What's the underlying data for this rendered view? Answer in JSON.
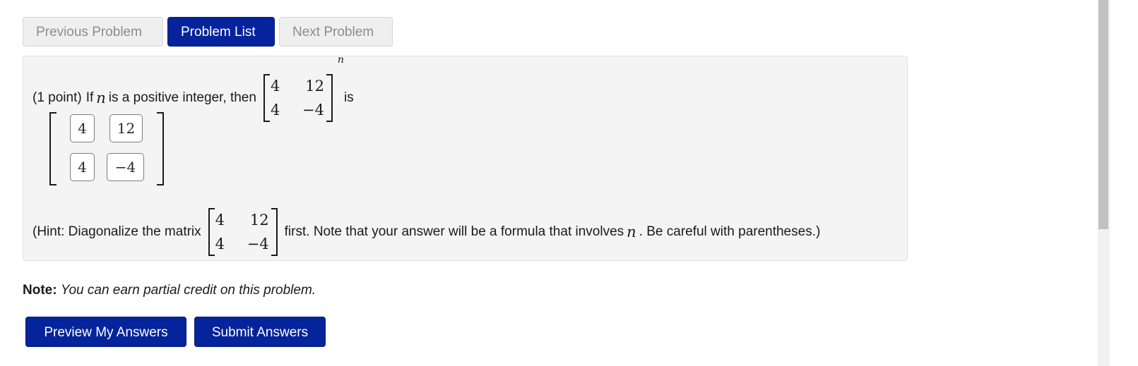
{
  "nav": {
    "previous_label": "Previous Problem",
    "list_label": "Problem List",
    "next_label": "Next Problem"
  },
  "problem": {
    "points": "(1 point)",
    "intro_if": "If",
    "variable": "n",
    "intro_rest": "is a positive integer, then",
    "matrix": [
      [
        "4",
        "12"
      ],
      [
        "4",
        "−4"
      ]
    ],
    "exponent": "n",
    "is_text": "is",
    "answer_cells": [
      [
        "4",
        "12"
      ],
      [
        "4",
        "−4"
      ]
    ],
    "hint_prefix": "(Hint: Diagonalize the matrix",
    "hint_matrix": [
      [
        "4",
        "12"
      ],
      [
        "4",
        "−4"
      ]
    ],
    "hint_middle": "first. Note that your answer will be a formula that involves",
    "hint_variable": "n",
    "hint_suffix": ". Be careful with parentheses.)"
  },
  "note": {
    "label": "Note:",
    "text": "You can earn partial credit on this problem."
  },
  "actions": {
    "preview_label": "Preview My Answers",
    "submit_label": "Submit Answers"
  },
  "colors": {
    "primary_button": "#05239a",
    "disabled_button": "#efefef",
    "problem_background": "#f4f4f4"
  }
}
